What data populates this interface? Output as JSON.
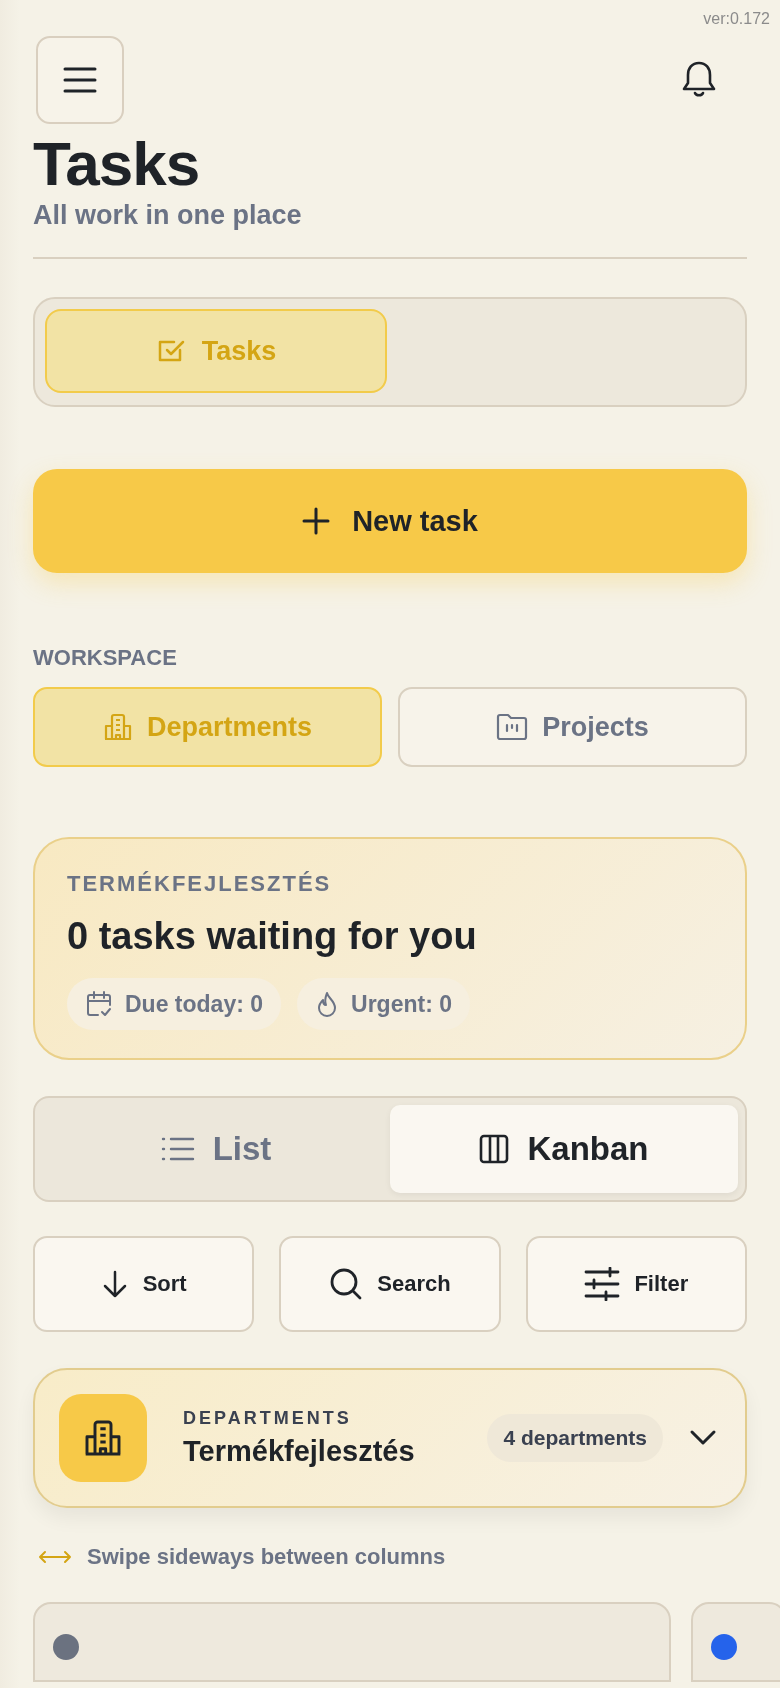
{
  "version": "ver:0.172",
  "header": {
    "title": "Tasks",
    "subtitle": "All work in one place"
  },
  "main_tabs": [
    {
      "label": "Tasks",
      "selected": true
    }
  ],
  "new_task_button": "New task",
  "workspace": {
    "label": "WORKSPACE",
    "options": [
      {
        "label": "Departments",
        "kind": "departments",
        "selected": true
      },
      {
        "label": "Projects",
        "kind": "projects",
        "selected": false
      }
    ]
  },
  "summary": {
    "eyebrow": "TERMÉKFEJLESZTÉS",
    "headline": "0 tasks waiting for you",
    "chips": [
      {
        "kind": "due",
        "label": "Due today: 0"
      },
      {
        "kind": "urgent",
        "label": "Urgent: 0"
      }
    ]
  },
  "view_toggle": [
    {
      "label": "List",
      "kind": "list",
      "selected": false
    },
    {
      "label": "Kanban",
      "kind": "kanban",
      "selected": true
    }
  ],
  "actions": [
    {
      "label": "Sort",
      "kind": "sort"
    },
    {
      "label": "Search",
      "kind": "search"
    },
    {
      "label": "Filter",
      "kind": "filter"
    }
  ],
  "department_picker": {
    "eyebrow": "DEPARTMENTS",
    "name": "Termékfejlesztés",
    "count": "4 departments",
    "expanded": false
  },
  "swipe_hint": "Swipe sideways between columns",
  "columns": [
    {
      "color": "#6b7280"
    },
    {
      "color": "#2563eb"
    }
  ]
}
